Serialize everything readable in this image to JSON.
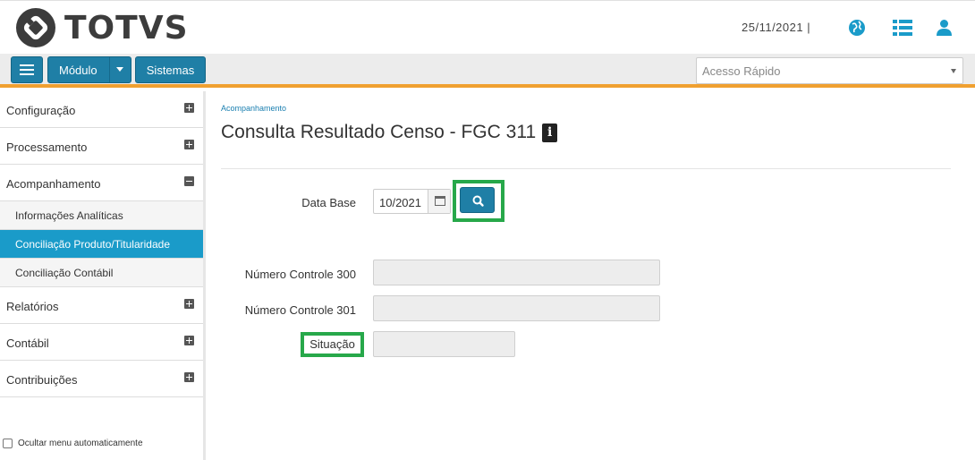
{
  "header": {
    "brand": "TOTVS",
    "date": "25/11/2021  |",
    "icons": [
      "globe-icon",
      "list-icon",
      "user-icon"
    ],
    "accent_color": "#1a9bc9"
  },
  "toolbar": {
    "modulo_label": "Módulo",
    "sistemas_label": "Sistemas",
    "quick_access_placeholder": "Acesso Rápido",
    "accent_bar_color": "#f0a030"
  },
  "sidebar": {
    "items": [
      {
        "label": "Configuração",
        "expanded": false
      },
      {
        "label": "Processamento",
        "expanded": false
      },
      {
        "label": "Acompanhamento",
        "expanded": true,
        "children": [
          {
            "label": "Informações Analíticas",
            "active": false
          },
          {
            "label": "Conciliação Produto/Titularidade",
            "active": true
          },
          {
            "label": "Conciliação Contábil",
            "active": false
          }
        ]
      },
      {
        "label": "Relatórios",
        "expanded": false
      },
      {
        "label": "Contábil",
        "expanded": false
      },
      {
        "label": "Contribuições",
        "expanded": false
      }
    ],
    "hide_menu_label": "Ocultar menu automaticamente"
  },
  "main": {
    "breadcrumb": "Acompanhamento",
    "title": "Consulta Resultado Censo - FGC 311",
    "fields": {
      "data_base_label": "Data Base",
      "data_base_value": "10/2021",
      "numero_300_label": "Número Controle 300",
      "numero_300_value": "",
      "numero_301_label": "Número Controle 301",
      "numero_301_value": "",
      "situacao_label": "Situação",
      "situacao_value": ""
    },
    "highlight_color": "#27a84a"
  }
}
